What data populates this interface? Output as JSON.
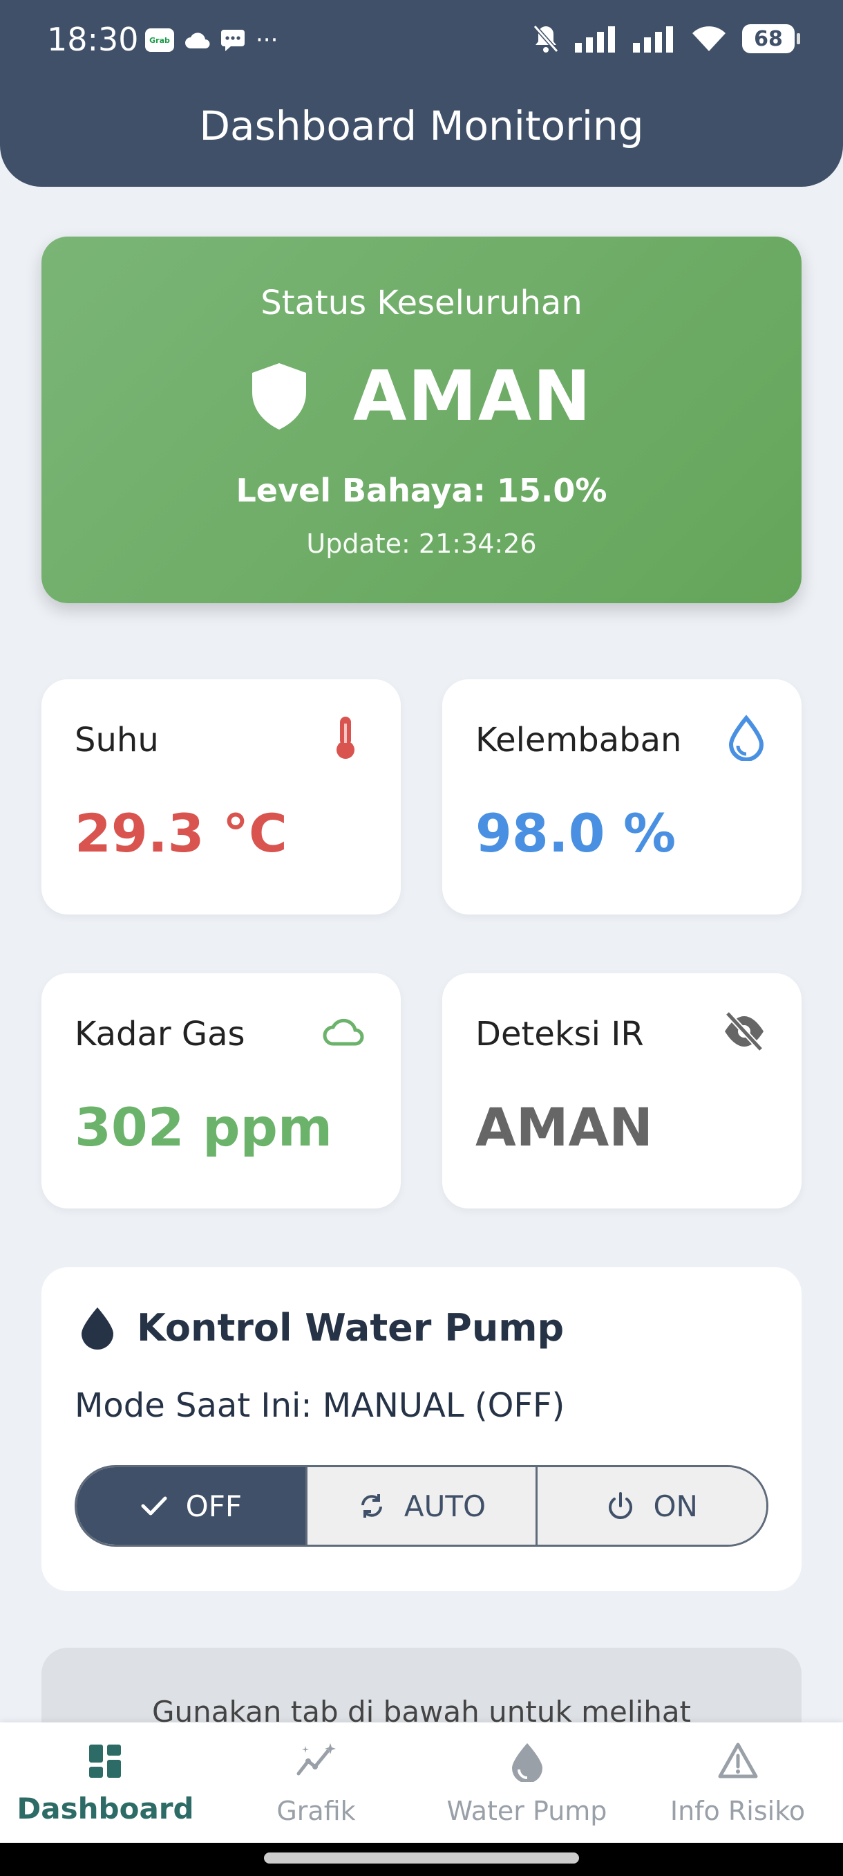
{
  "status_bar": {
    "time": "18:30",
    "grab_label": "Grab",
    "more": "···",
    "battery": "68"
  },
  "header": {
    "title": "Dashboard Monitoring"
  },
  "overall": {
    "title": "Status Keseluruhan",
    "status": "AMAN",
    "level": "Level Bahaya: 15.0%",
    "update": "Update: 21:34:26"
  },
  "sensors": [
    {
      "label": "Suhu",
      "value": "29.3 °C",
      "color": "#d9534f",
      "icon": "thermometer-icon"
    },
    {
      "label": "Kelembaban",
      "value": "98.0 %",
      "color": "#4a90e2",
      "icon": "droplet-icon"
    },
    {
      "label": "Kadar Gas",
      "value": "302 ppm",
      "color": "#6bb26a",
      "icon": "cloud-icon"
    },
    {
      "label": "Deteksi IR",
      "value": "AMAN",
      "color": "#666666",
      "icon": "eye-off-icon"
    }
  ],
  "pump": {
    "title": "Kontrol Water Pump",
    "mode": "Mode Saat Ini: MANUAL (OFF)",
    "buttons": [
      {
        "label": "OFF",
        "active": true
      },
      {
        "label": "AUTO",
        "active": false
      },
      {
        "label": "ON",
        "active": false
      }
    ]
  },
  "hint": {
    "text": "Gunakan tab di bawah untuk melihat"
  },
  "nav": [
    {
      "label": "Dashboard",
      "active": true
    },
    {
      "label": "Grafik",
      "active": false
    },
    {
      "label": "Water Pump",
      "active": false
    },
    {
      "label": "Info Risiko",
      "active": false
    }
  ],
  "colors": {
    "header": "#3f5068",
    "safe_green": "#6aab62",
    "active_nav": "#2d6b66"
  }
}
